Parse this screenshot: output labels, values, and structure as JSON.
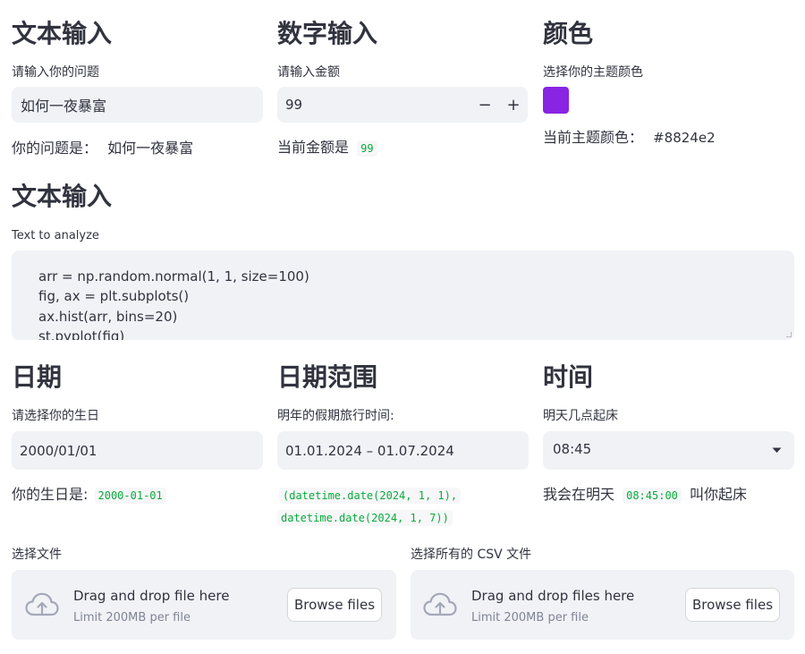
{
  "text_input": {
    "heading": "文本输入",
    "label": "请输入你的问题",
    "value": "如何一夜暴富",
    "result_prefix": "你的问题是：",
    "result_value": "如何一夜暴富"
  },
  "number_input": {
    "heading": "数字输入",
    "label": "请输入金额",
    "value": "99",
    "minus": "−",
    "plus": "+",
    "result_prefix": "当前金额是",
    "result_value": "99"
  },
  "color": {
    "heading": "颜色",
    "label": "选择你的主题颜色",
    "value": "#8824e2",
    "result_prefix": "当前主题颜色：",
    "result_value": "#8824e2"
  },
  "text_area": {
    "heading": "文本输入",
    "label": "Text to analyze",
    "lines": [
      "arr = np.random.normal(1, 1, size=100)",
      "fig, ax = plt.subplots()",
      "ax.hist(arr, bins=20)",
      "st.pyplot(fig)"
    ]
  },
  "date": {
    "heading": "日期",
    "label": "请选择你的生日",
    "value": "2000/01/01",
    "result_prefix": "你的生日是:",
    "result_value": "2000-01-01"
  },
  "date_range": {
    "heading": "日期范围",
    "label": "明年的假期旅行时间:",
    "value": "01.01.2024 – 01.07.2024",
    "result_line1": "(datetime.date(2024, 1, 1),",
    "result_line2": "datetime.date(2024, 1, 7))"
  },
  "time": {
    "heading": "时间",
    "label": "明天几点起床",
    "value": "08:45",
    "result_prefix": "我会在明天",
    "result_value": "08:45:00",
    "result_suffix": "叫你起床"
  },
  "uploader_single": {
    "label": "选择文件",
    "title": "Drag and drop file here",
    "limit": "Limit 200MB per file",
    "button": "Browse files"
  },
  "uploader_multi": {
    "label": "选择所有的 CSV 文件",
    "title": "Drag and drop files here",
    "limit": "Limit 200MB per file",
    "button": "Browse files"
  }
}
